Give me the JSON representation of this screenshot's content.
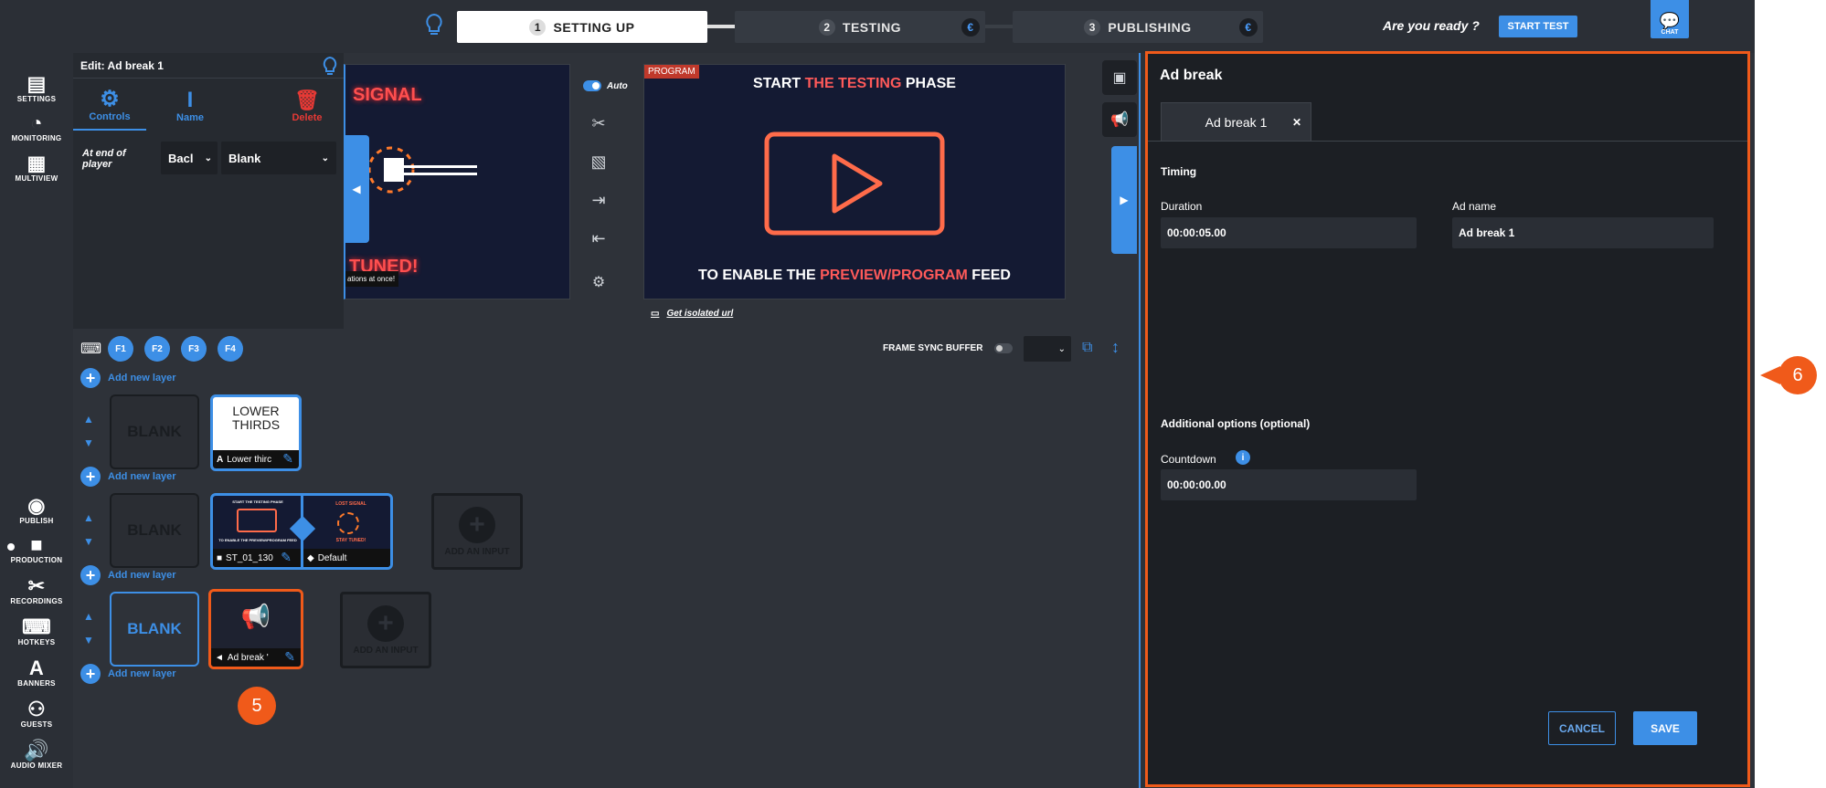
{
  "steps": [
    {
      "num": "1",
      "label": "SETTING UP"
    },
    {
      "num": "2",
      "label": "TESTING",
      "badge": "€"
    },
    {
      "num": "3",
      "label": "PUBLISHING",
      "badge": "€"
    }
  ],
  "topbar": {
    "ready": "Are you ready ?",
    "start_test": "START TEST",
    "chat": "CHAT"
  },
  "leftnav": {
    "top": [
      "SETTINGS",
      "MONITORING",
      "MULTIVIEW"
    ],
    "bottom": [
      "PUBLISH",
      "PRODUCTION",
      "RECORDINGS",
      "HOTKEYS",
      "BANNERS",
      "GUESTS",
      "AUDIO MIXER"
    ]
  },
  "edit": {
    "title": "Edit: Ad break 1",
    "tabs": [
      "Controls",
      "Name",
      "Delete"
    ],
    "end_label": "At end of player",
    "sel1": "Bacl",
    "sel2": "Blank"
  },
  "preview": {
    "signal": "SIGNAL",
    "tuned": "TUNED!",
    "note": "ations at once!",
    "auto": "Auto",
    "program_label": "PROGRAM",
    "line1a": "START ",
    "line1b": "THE TESTING",
    "line1c": " PHASE",
    "line2a": "TO ENABLE THE ",
    "line2b": "PREVIEW/PROGRAM",
    "line2c": " FEED",
    "isolated": "Get isolated url"
  },
  "timeline": {
    "fkeys": [
      "F1",
      "F2",
      "F3",
      "F4"
    ],
    "frame_sync": "FRAME SYNC BUFFER",
    "add_layer": "Add new layer",
    "blank": "BLANK",
    "add_input": "ADD AN INPUT",
    "lower_thirds_title": "LOWER THIRDS",
    "lower_thirds_cap": "Lower thirc",
    "st_cap": "ST_01_130",
    "default_cap": "Default",
    "adbreak_cap": "Ad break '",
    "mini_start": "START THE TESTING PHASE",
    "mini_lost": "LOST SIGNAL",
    "mini_enable": "TO ENABLE THE PREVIEW/PROGRAM FEED",
    "mini_tuned": "STAY TUNED!"
  },
  "panel": {
    "title": "Ad break",
    "tab": "Ad break 1",
    "timing": "Timing",
    "duration_label": "Duration",
    "duration_value": "00:00:05.00",
    "adname_label": "Ad name",
    "adname_value": "Ad break 1",
    "additional": "Additional options (optional)",
    "countdown_label": "Countdown",
    "countdown_value": "00:00:00.00",
    "cancel": "CANCEL",
    "save": "SAVE"
  },
  "badges": {
    "b5": "5",
    "b6": "6"
  },
  "colors": {
    "accent": "#3d8fe6",
    "highlight": "#f05a1a",
    "danger": "#e53935"
  }
}
